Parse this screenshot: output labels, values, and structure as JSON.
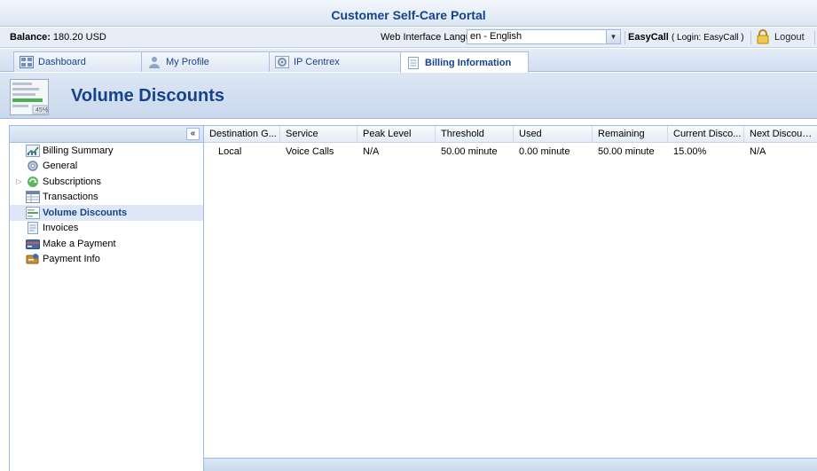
{
  "app": {
    "title": "Customer Self-Care Portal"
  },
  "status": {
    "balance_label": "Balance:",
    "balance_value": "180.20 USD",
    "language_label": "Web Interface Language:",
    "language_value": "en - English",
    "user_name": "EasyCall",
    "login_info": "( Login: EasyCall )",
    "logout_label": "Logout"
  },
  "tabs": [
    {
      "label": "Dashboard"
    },
    {
      "label": "My Profile"
    },
    {
      "label": "IP Centrex"
    },
    {
      "label": "Billing Information"
    }
  ],
  "page": {
    "title": "Volume Discounts"
  },
  "sidebar": {
    "collapse_glyph": "«",
    "items": [
      {
        "label": "Billing Summary"
      },
      {
        "label": "General"
      },
      {
        "label": "Subscriptions"
      },
      {
        "label": "Transactions"
      },
      {
        "label": "Volume Discounts"
      },
      {
        "label": "Invoices"
      },
      {
        "label": "Make a Payment"
      },
      {
        "label": "Payment Info"
      }
    ]
  },
  "grid": {
    "columns": [
      "Destination G...",
      "Service",
      "Peak Level",
      "Threshold",
      "Used",
      "Remaining",
      "Current Disco...",
      "Next Discount..."
    ],
    "rows": [
      [
        "Local",
        "Voice Calls",
        "N/A",
        "50.00 minute",
        "0.00 minute",
        "50.00 minute",
        "15.00%",
        "N/A"
      ]
    ]
  },
  "colors": {
    "accent": "#15428b",
    "border": "#99bbe8",
    "selected": "#dfe8f6"
  }
}
